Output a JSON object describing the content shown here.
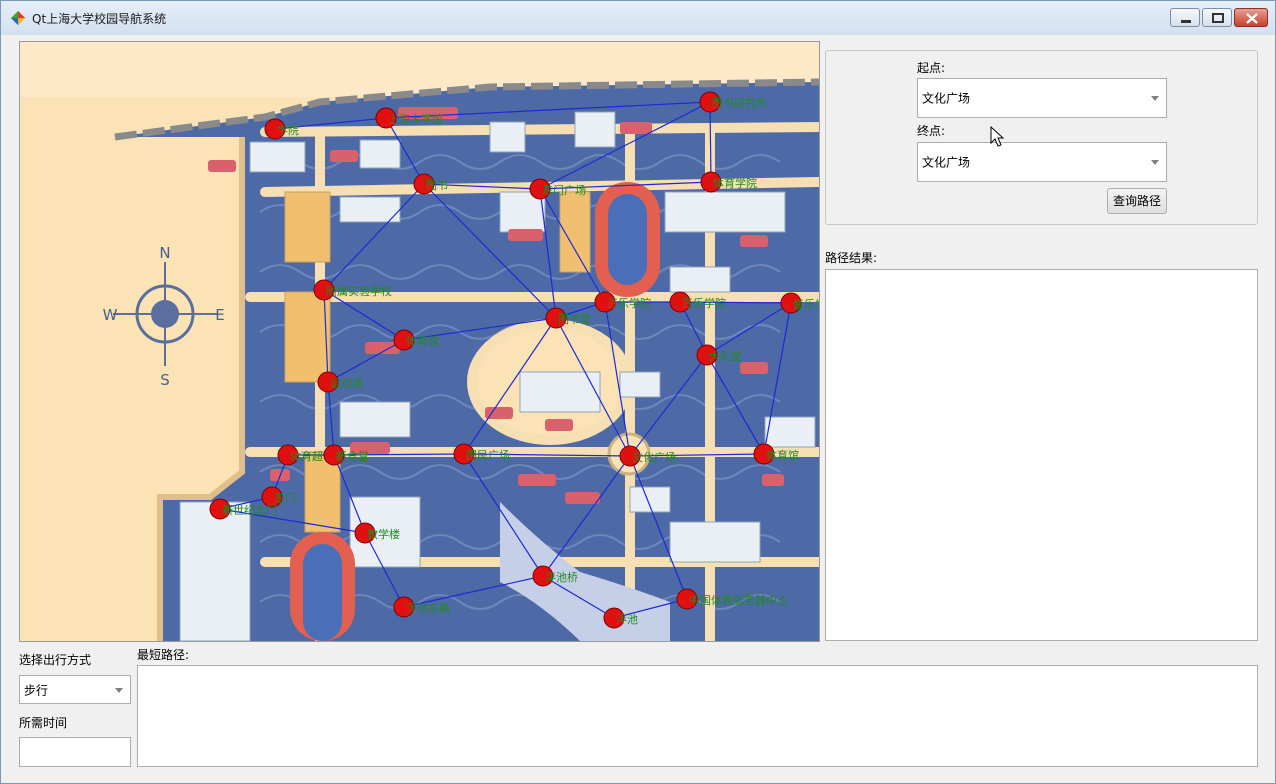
{
  "window": {
    "title": "Qt上海大学校园导航系统"
  },
  "query": {
    "start_label": "起点:",
    "start_value": "文化广场",
    "end_label": "终点:",
    "end_value": "文化广场",
    "search_button": "查询路径"
  },
  "result": {
    "label": "路径结果:",
    "text": ""
  },
  "travel": {
    "mode_label": "选择出行方式",
    "mode_value": "步行",
    "time_label": "所需时间",
    "time_value": ""
  },
  "shortest": {
    "label": "最短路径:",
    "text": ""
  },
  "map": {
    "nodes": [
      {
        "name": "学院"
      },
      {
        "name": "上海大学馆"
      },
      {
        "name": "图书研究所"
      },
      {
        "name": "图书"
      },
      {
        "name": "东门广场"
      },
      {
        "name": "体育学院"
      },
      {
        "name": "附属实验学校"
      },
      {
        "name": "图书馆"
      },
      {
        "name": "音乐学院"
      },
      {
        "name": "音乐学院"
      },
      {
        "name": "音乐学院"
      },
      {
        "name": "体育馆"
      },
      {
        "name": "大礼堂"
      },
      {
        "name": "运动场"
      },
      {
        "name": "体育超市"
      },
      {
        "name": "新食堂"
      },
      {
        "name": "国民广场"
      },
      {
        "name": "文化广场"
      },
      {
        "name": "体育馆"
      },
      {
        "name": "东门"
      },
      {
        "name": "新世纪北门"
      },
      {
        "name": "教学楼"
      },
      {
        "name": "泮池桥"
      },
      {
        "name": "泮池东路"
      },
      {
        "name": "中国体育服务器中心"
      },
      {
        "name": "泮池"
      }
    ],
    "compass": {
      "n": "N",
      "s": "S",
      "e": "E",
      "w": "W"
    },
    "colors": {
      "edge": "#1a2bd6",
      "node": "#e01010",
      "label": "#1f8a1f"
    }
  }
}
